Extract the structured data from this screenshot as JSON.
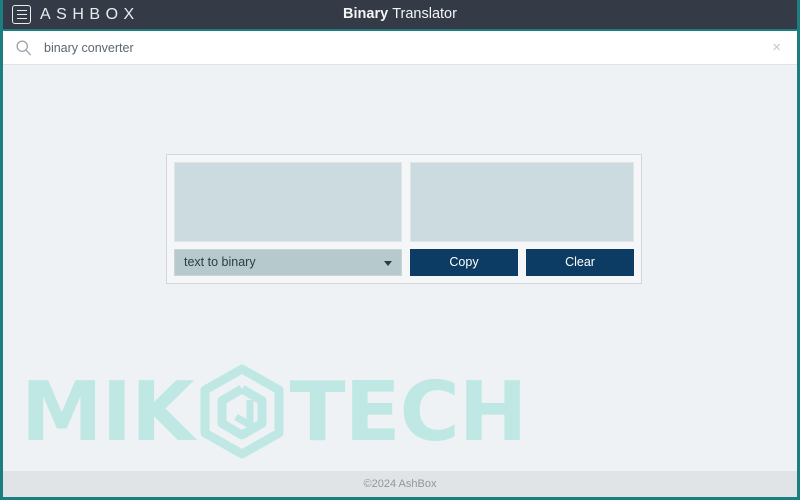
{
  "titlebar": {
    "menu_icon": "menu-icon",
    "brand": "ASHBOX",
    "title_strong": "Binary",
    "title_light": "Translator",
    "bg_color": "#343a46",
    "accent_color": "#1b7f82"
  },
  "search": {
    "icon": "search-icon",
    "value": "binary converter",
    "placeholder": "Search",
    "clear_icon": "×"
  },
  "tool": {
    "input_value": "",
    "input_placeholder": "",
    "output_value": "",
    "output_placeholder": "",
    "mode_selected": "text to binary",
    "mode_options": [
      "text to binary"
    ],
    "copy_label": "Copy",
    "clear_label": "Clear",
    "button_color": "#0c3c63",
    "field_color": "#cbdbdf",
    "select_color": "#b6c9cc"
  },
  "watermark": {
    "text_before": "MIK",
    "logo_icon": "hexagon-spiral-icon",
    "text_after": "TECH",
    "color": "#bfe8e5"
  },
  "footer": {
    "copyright": "©2024 AshBox"
  }
}
